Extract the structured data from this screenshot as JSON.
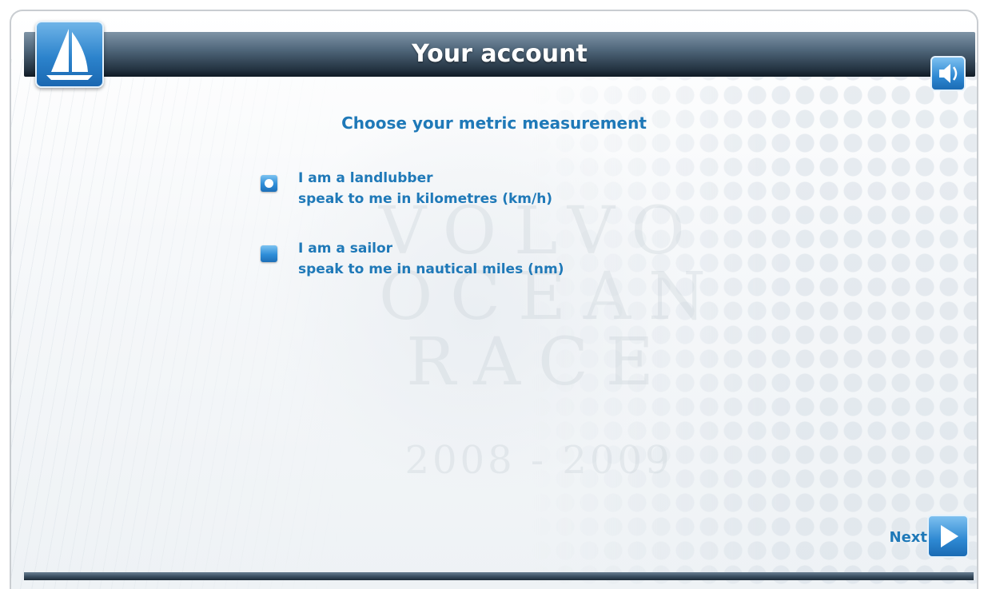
{
  "header": {
    "title": "Your account"
  },
  "main": {
    "heading": "Choose your metric measurement",
    "options": [
      {
        "line1": "I am a landlubber",
        "line2": "speak to me in kilometres (km/h)",
        "selected": true
      },
      {
        "line1": "I am a sailor",
        "line2": "speak to me in nautical miles (nm)",
        "selected": false
      }
    ]
  },
  "background": {
    "watermark": [
      "VOLVO",
      "OCEAN",
      "RACE"
    ],
    "watermark_year": "2008 - 2009"
  },
  "footer": {
    "next_label": "Next"
  },
  "icons": {
    "logo": "sailboat-icon",
    "sound": "speaker-icon",
    "next": "play-arrow-icon"
  },
  "colors": {
    "accent_text": "#1f79b8",
    "button_blue": "#2d88d2",
    "header_dark": "#22313f"
  }
}
